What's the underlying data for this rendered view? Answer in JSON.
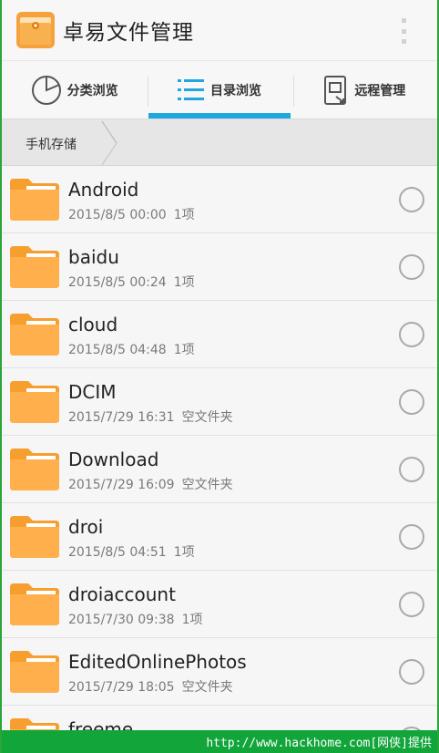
{
  "app": {
    "title": "卓易文件管理",
    "icon": "folder-logo-icon"
  },
  "tabs": [
    {
      "label": "分类浏览",
      "icon": "pie-chart-icon",
      "active": false
    },
    {
      "label": "目录浏览",
      "icon": "list-icon",
      "active": true
    },
    {
      "label": "远程管理",
      "icon": "remote-device-icon",
      "active": false
    }
  ],
  "breadcrumb": {
    "label": "手机存储"
  },
  "files": [
    {
      "name": "Android",
      "date": "2015/8/5 00:00",
      "count": "1项"
    },
    {
      "name": "baidu",
      "date": "2015/8/5 00:24",
      "count": "1项"
    },
    {
      "name": "cloud",
      "date": "2015/8/5 04:48",
      "count": "1项"
    },
    {
      "name": "DCIM",
      "date": "2015/7/29 16:31",
      "count": "空文件夹"
    },
    {
      "name": "Download",
      "date": "2015/7/29 16:09",
      "count": "空文件夹"
    },
    {
      "name": "droi",
      "date": "2015/8/5 04:51",
      "count": "1项"
    },
    {
      "name": "droiaccount",
      "date": "2015/7/30 09:38",
      "count": "1项"
    },
    {
      "name": "EditedOnlinePhotos",
      "date": "2015/7/29 18:05",
      "count": "空文件夹"
    },
    {
      "name": "freeme",
      "date": "",
      "count": ""
    }
  ],
  "watermark": {
    "text": "http://www.hackhome.com[网侠]提供"
  },
  "colors": {
    "accent": "#1fa7e0",
    "folder": "#ffaf4b",
    "watermark_bg": "#11a53a"
  }
}
